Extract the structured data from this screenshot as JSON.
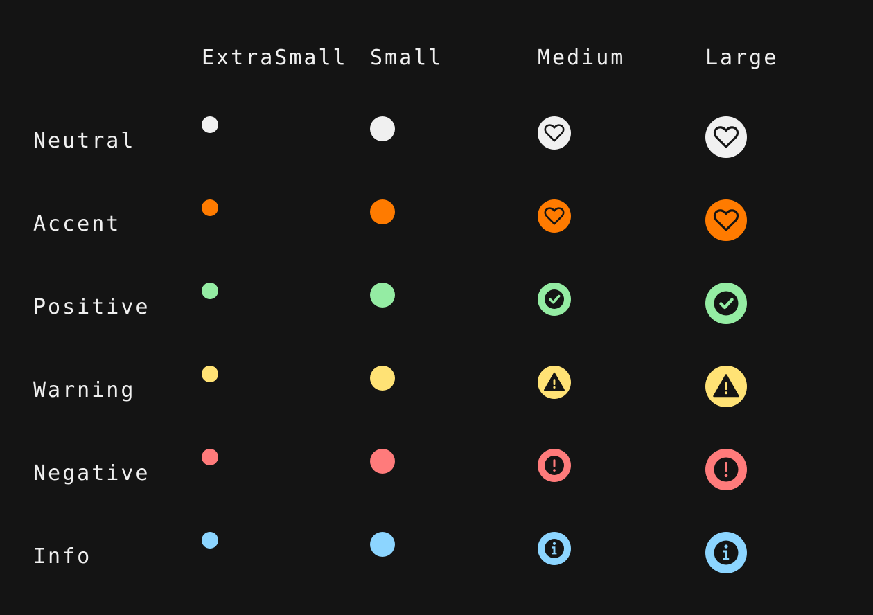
{
  "columns": {
    "extra_small": "ExtraSmall",
    "small": "Small",
    "medium": "Medium",
    "large": "Large"
  },
  "rows": [
    {
      "label": "Neutral",
      "color": "#f0f0f0",
      "icon": "heart-icon"
    },
    {
      "label": "Accent",
      "color": "#ff7b00",
      "icon": "heart-icon"
    },
    {
      "label": "Positive",
      "color": "#94eca3",
      "icon": "check-circle-icon"
    },
    {
      "label": "Warning",
      "color": "#ffe275",
      "icon": "warning-triangle-icon"
    },
    {
      "label": "Negative",
      "color": "#ff7b7b",
      "icon": "error-circle-icon"
    },
    {
      "label": "Info",
      "color": "#8cd5ff",
      "icon": "info-circle-icon"
    }
  ],
  "background": "#141414",
  "icon_color": "#141414"
}
